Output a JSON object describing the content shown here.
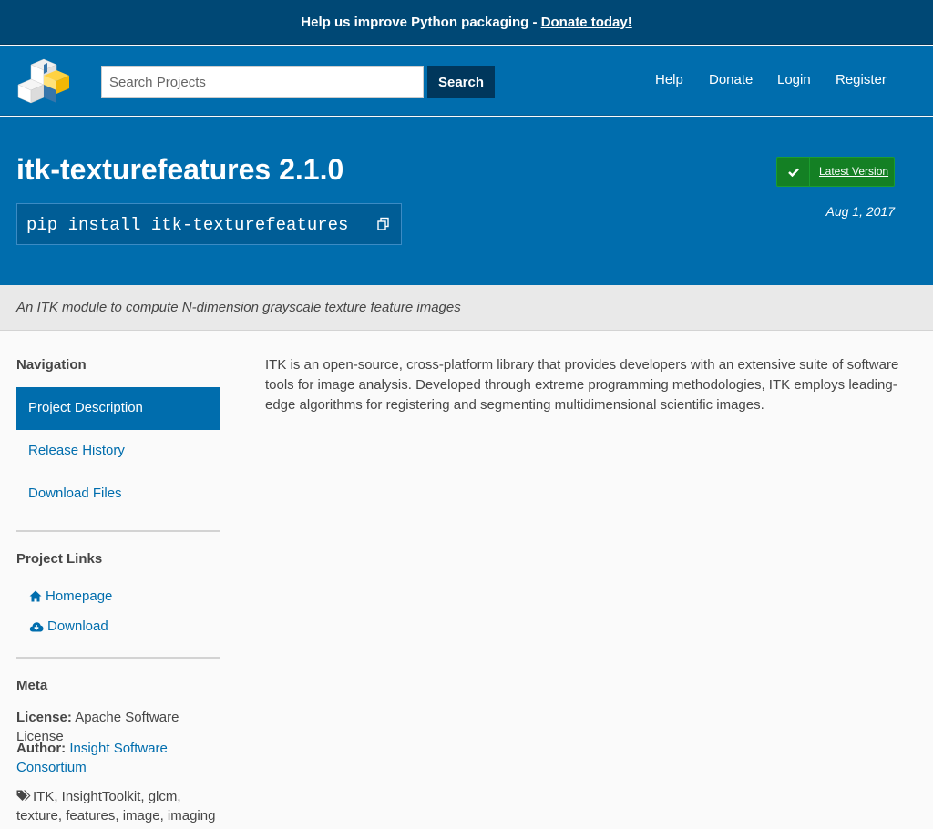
{
  "banner": {
    "text": "Help us improve Python packaging - ",
    "link": "Donate today!"
  },
  "header": {
    "search_placeholder": "Search Projects",
    "search_button": "Search",
    "nav": [
      "Help",
      "Donate",
      "Login",
      "Register"
    ]
  },
  "project": {
    "title": "itk-texturefeatures 2.1.0",
    "pip_command": "pip install itk-texturefeatures",
    "latest_label": "Latest Version",
    "release_date": "Aug 1, 2017",
    "summary": "An ITK module to compute N-dimension grayscale texture feature images"
  },
  "sidebar": {
    "navigation_heading": "Navigation",
    "nav_items": [
      "Project Description",
      "Release History",
      "Download Files"
    ],
    "links_heading": "Project Links",
    "links": [
      "Homepage",
      "Download"
    ],
    "meta_heading": "Meta",
    "license_label": "License:",
    "license_value": "Apache Software License",
    "author_label": "Author:",
    "author_value": "Insight Software Consortium",
    "keywords": "ITK, InsightToolkit, glcm, texture, features, image, imaging"
  },
  "description": "ITK is an open-source, cross-platform library that provides developers with an extensive suite of software tools for image analysis. Developed through extreme programming methodologies, ITK employs leading-edge algorithms for registering and segmenting multidimensional scientific images.",
  "colors": {
    "brand": "#006dad",
    "banner": "#004875",
    "latest": "#148024"
  }
}
